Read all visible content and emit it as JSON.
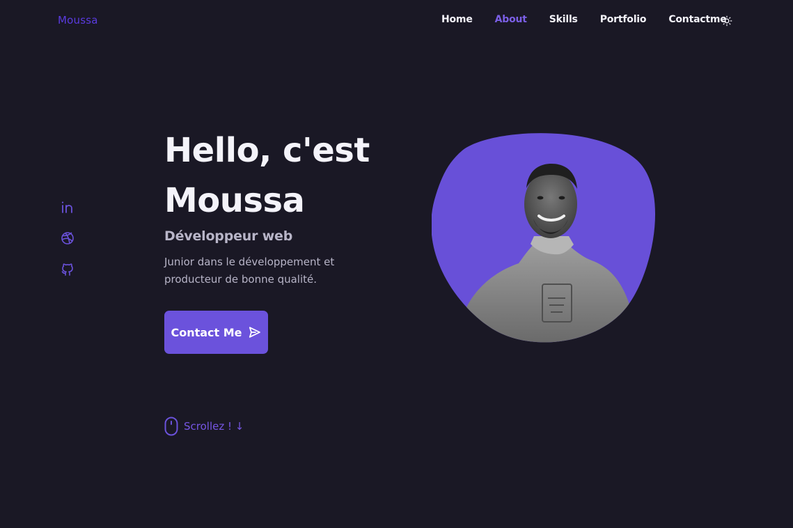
{
  "brand": {
    "name": "Moussa",
    "accent": "#6b52dc"
  },
  "nav": {
    "items": [
      {
        "label": "Home",
        "active": false
      },
      {
        "label": "About",
        "active": true
      },
      {
        "label": "Skills",
        "active": false
      },
      {
        "label": "Portfolio",
        "active": false
      },
      {
        "label": "Contactme",
        "active": false
      }
    ],
    "theme_icon": "sun-icon"
  },
  "socials": [
    {
      "name": "linkedin-icon"
    },
    {
      "name": "dribbble-icon"
    },
    {
      "name": "github-icon"
    }
  ],
  "hero": {
    "title_line1": "Hello, c'est",
    "title_line2": "Moussa",
    "subtitle": "Développeur web",
    "description": "Junior dans le développement et producteur de bonne qualité.",
    "contact_label": "Contact Me",
    "scroll_label": "Scrollez ! ↓"
  },
  "colors": {
    "background": "#1a1825",
    "text": "#f4f3fa",
    "muted": "#b8b5c8",
    "accent": "#6b52dc",
    "accent_light": "#7b5fe6"
  }
}
